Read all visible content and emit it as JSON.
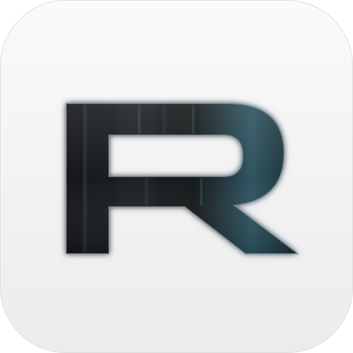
{
  "app_icon": {
    "logo_mark": "letter-r-logo",
    "colors": {
      "tile_background": "#f3f3f4",
      "tile_border": "#dcdcde",
      "logo_dark": "#0e1214",
      "logo_accent": "#3e6a78",
      "logo_edge": "#9aa4a8"
    }
  }
}
